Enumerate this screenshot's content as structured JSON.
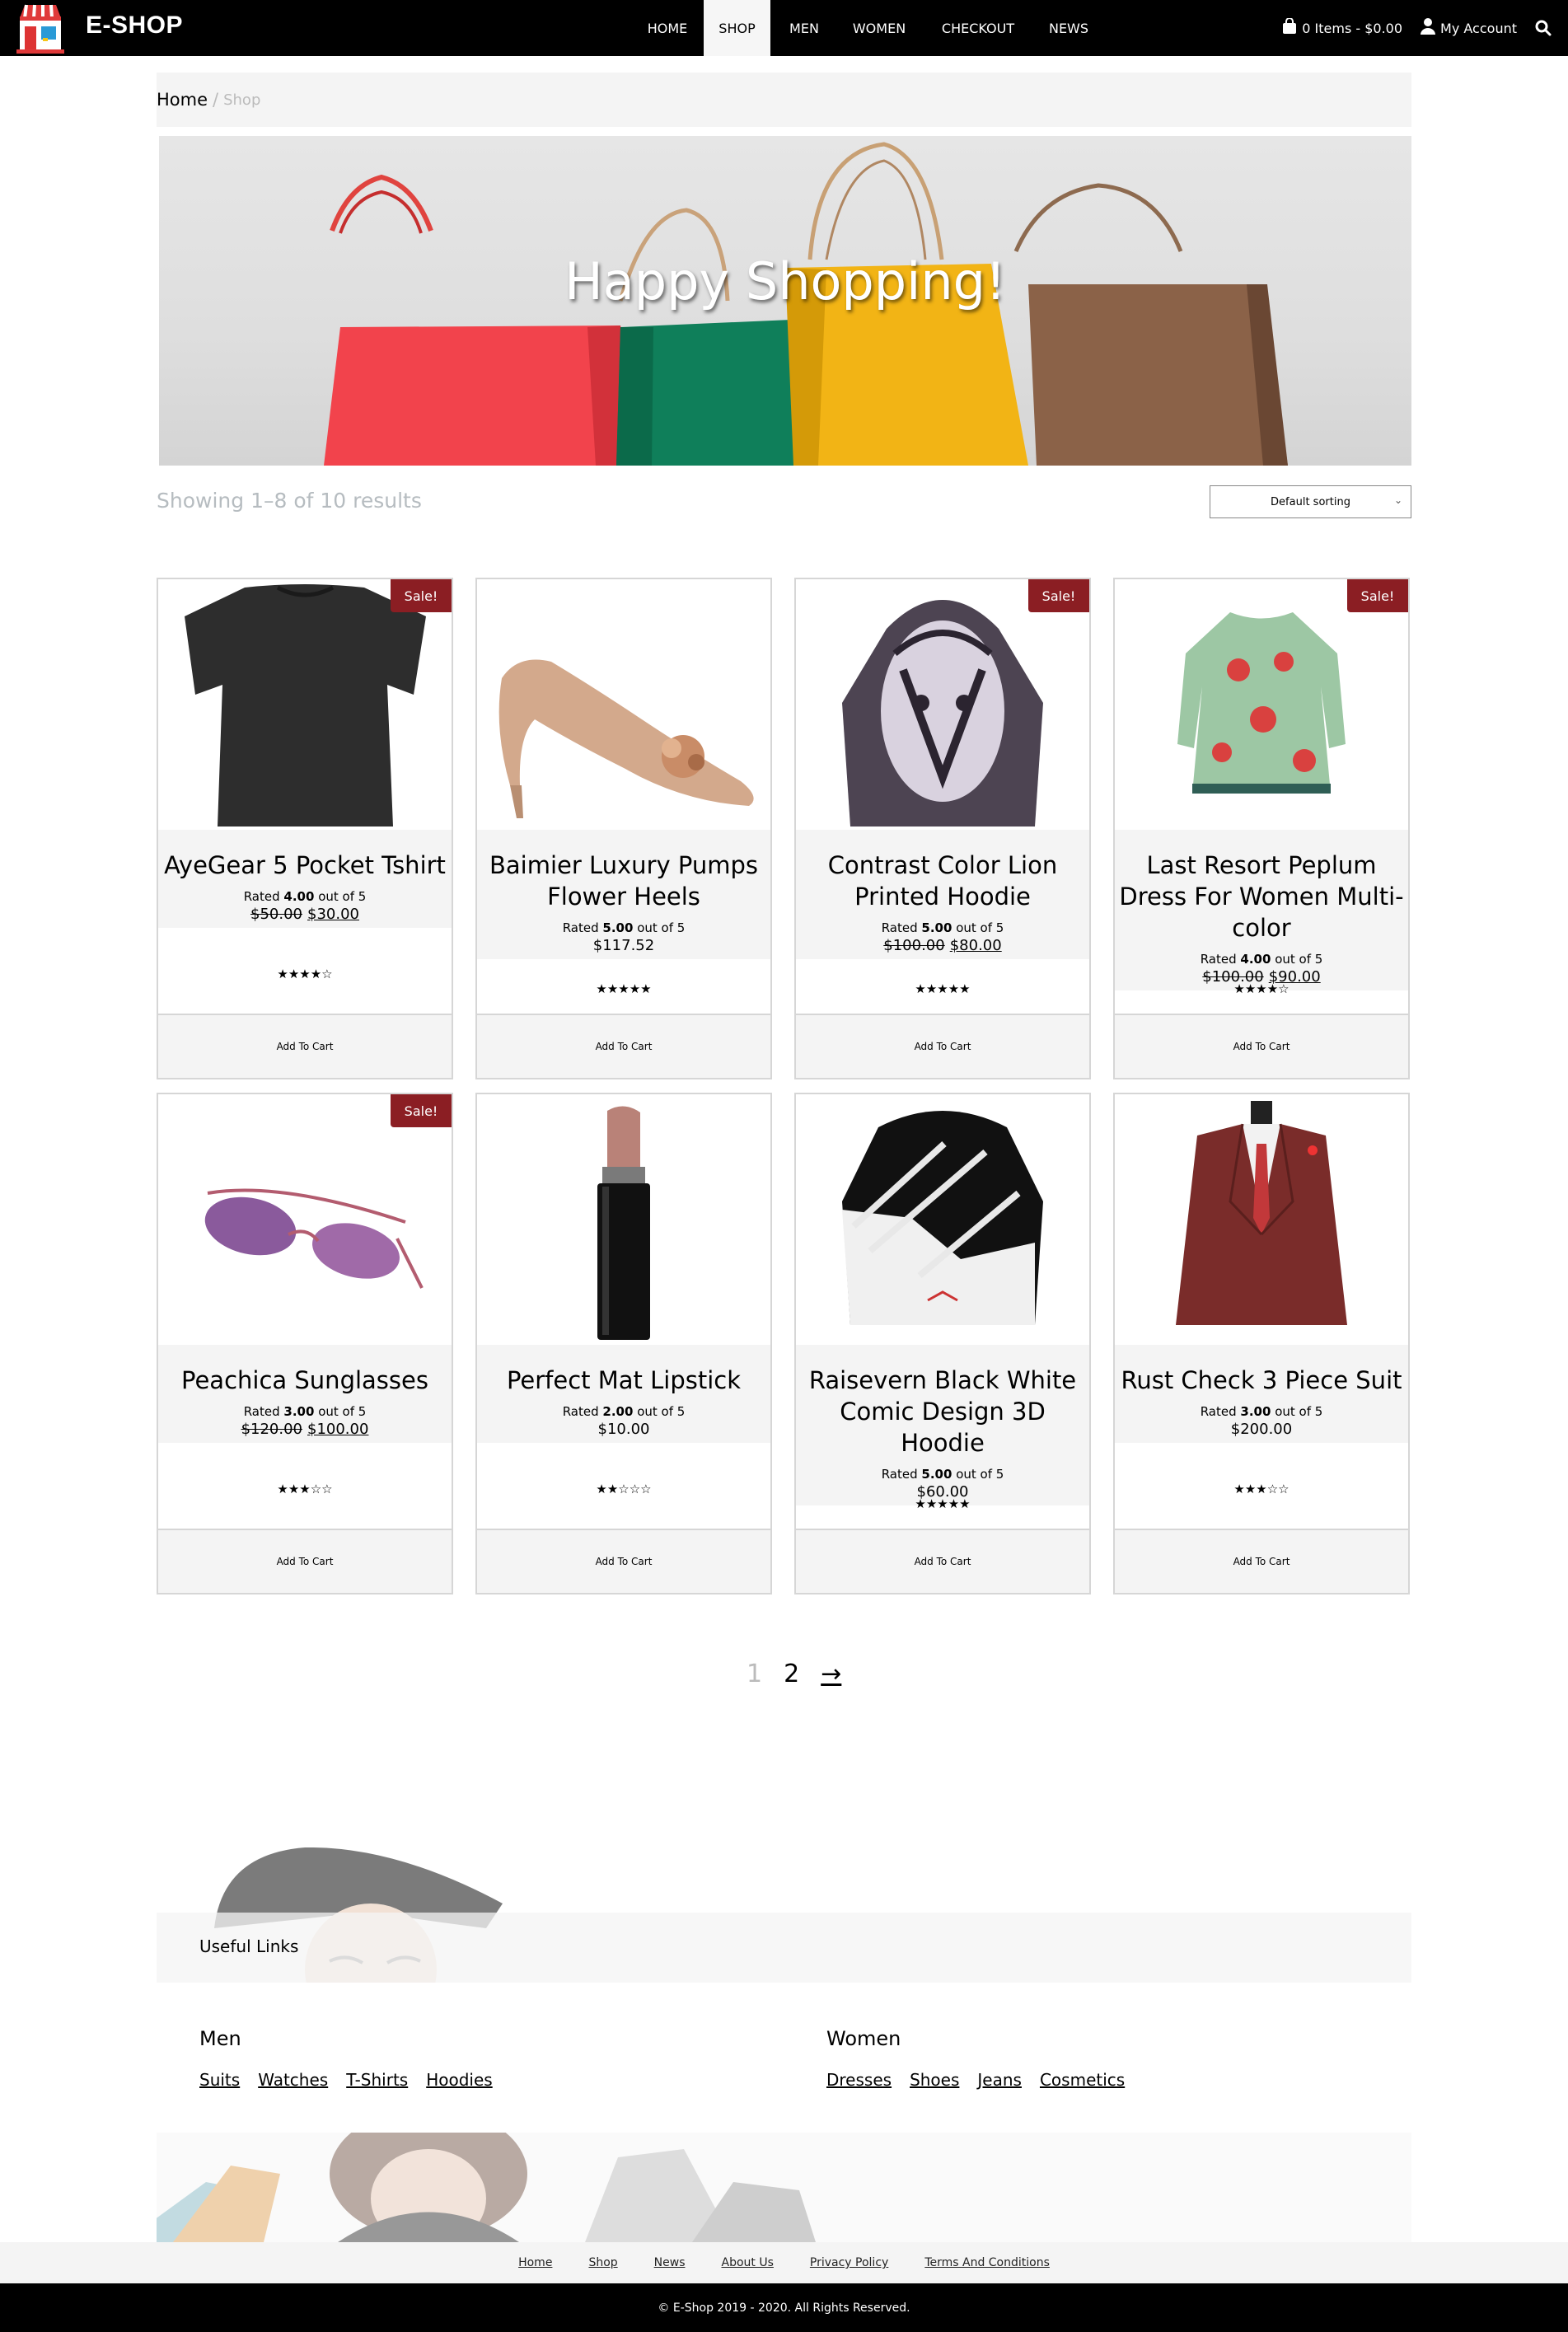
{
  "header": {
    "brand": "E-SHOP",
    "nav": [
      {
        "label": "HOME"
      },
      {
        "label": "SHOP"
      },
      {
        "label": "MEN"
      },
      {
        "label": "WOMEN"
      },
      {
        "label": "CHECKOUT"
      },
      {
        "label": "NEWS"
      }
    ],
    "active_nav": "SHOP",
    "cart": "0 Items - $0.00",
    "account": "My Account",
    "icons": [
      "store-logo-icon",
      "shopping-bag-icon",
      "user-icon",
      "search-icon"
    ]
  },
  "breadcrumb": {
    "home": "Home",
    "separator": "/",
    "current": "Shop"
  },
  "hero": {
    "title": "Happy Shopping!"
  },
  "results": {
    "text": "Showing 1–8 of 10 results"
  },
  "sorting": {
    "selected": "Default sorting"
  },
  "products": [
    {
      "name": "AyeGear 5 Pocket Tshirt",
      "rated_prefix": "Rated",
      "rating": "4.00",
      "rated_suffix": "out of 5",
      "old_price": "$50.00",
      "price": "$30.00",
      "sale": "Sale!",
      "stars": 4,
      "add_to_cart": "Add To Cart"
    },
    {
      "name": "Baimier Luxury Pumps Flower Heels",
      "rated_prefix": "Rated",
      "rating": "5.00",
      "rated_suffix": "out of 5",
      "old_price": "",
      "price": "$117.52",
      "sale": "",
      "stars": 5,
      "add_to_cart": "Add To Cart"
    },
    {
      "name": "Contrast Color Lion Printed Hoodie",
      "rated_prefix": "Rated",
      "rating": "5.00",
      "rated_suffix": "out of 5",
      "old_price": "$100.00",
      "price": "$80.00",
      "sale": "Sale!",
      "stars": 5,
      "add_to_cart": "Add To Cart"
    },
    {
      "name": "Last Resort Peplum Dress For Women Multi-color",
      "rated_prefix": "Rated",
      "rating": "4.00",
      "rated_suffix": "out of 5",
      "old_price": "$100.00",
      "price": "$90.00",
      "sale": "Sale!",
      "stars": 4,
      "add_to_cart": "Add To Cart"
    },
    {
      "name": "Peachica Sunglasses",
      "rated_prefix": "Rated",
      "rating": "3.00",
      "rated_suffix": "out of 5",
      "old_price": "$120.00",
      "price": "$100.00",
      "sale": "Sale!",
      "stars": 3,
      "add_to_cart": "Add To Cart"
    },
    {
      "name": "Perfect Mat Lipstick",
      "rated_prefix": "Rated",
      "rating": "2.00",
      "rated_suffix": "out of 5",
      "old_price": "",
      "price": "$10.00",
      "sale": "",
      "stars": 2,
      "add_to_cart": "Add To Cart"
    },
    {
      "name": "Raisevern Black White Comic Design 3D Hoodie",
      "rated_prefix": "Rated",
      "rating": "5.00",
      "rated_suffix": "out of 5",
      "old_price": "",
      "price": "$60.00",
      "sale": "",
      "stars": 5,
      "add_to_cart": "Add To Cart"
    },
    {
      "name": "Rust Check 3 Piece Suit",
      "rated_prefix": "Rated",
      "rating": "3.00",
      "rated_suffix": "out of 5",
      "old_price": "",
      "price": "$200.00",
      "sale": "",
      "stars": 3,
      "add_to_cart": "Add To Cart"
    }
  ],
  "pagination": {
    "current": "1",
    "next_page": "2",
    "arrow": "→"
  },
  "footer": {
    "useful_links": "Useful Links",
    "men": {
      "title": "Men",
      "links": [
        "Suits",
        "Watches",
        "T-Shirts",
        "Hoodies"
      ]
    },
    "women": {
      "title": "Women",
      "links": [
        "Dresses",
        "Shoes",
        "Jeans",
        "Cosmetics"
      ]
    },
    "bottom_links": [
      "Home",
      "Shop",
      "News",
      "About Us",
      "Privacy Policy",
      "Terms And Conditions"
    ],
    "copyright": "© E-Shop 2019 - 2020. All Rights Reserved."
  },
  "colors": {
    "sale_badge": "#8b1e23",
    "topbar": "#000000",
    "panel": "#f4f4f4"
  }
}
